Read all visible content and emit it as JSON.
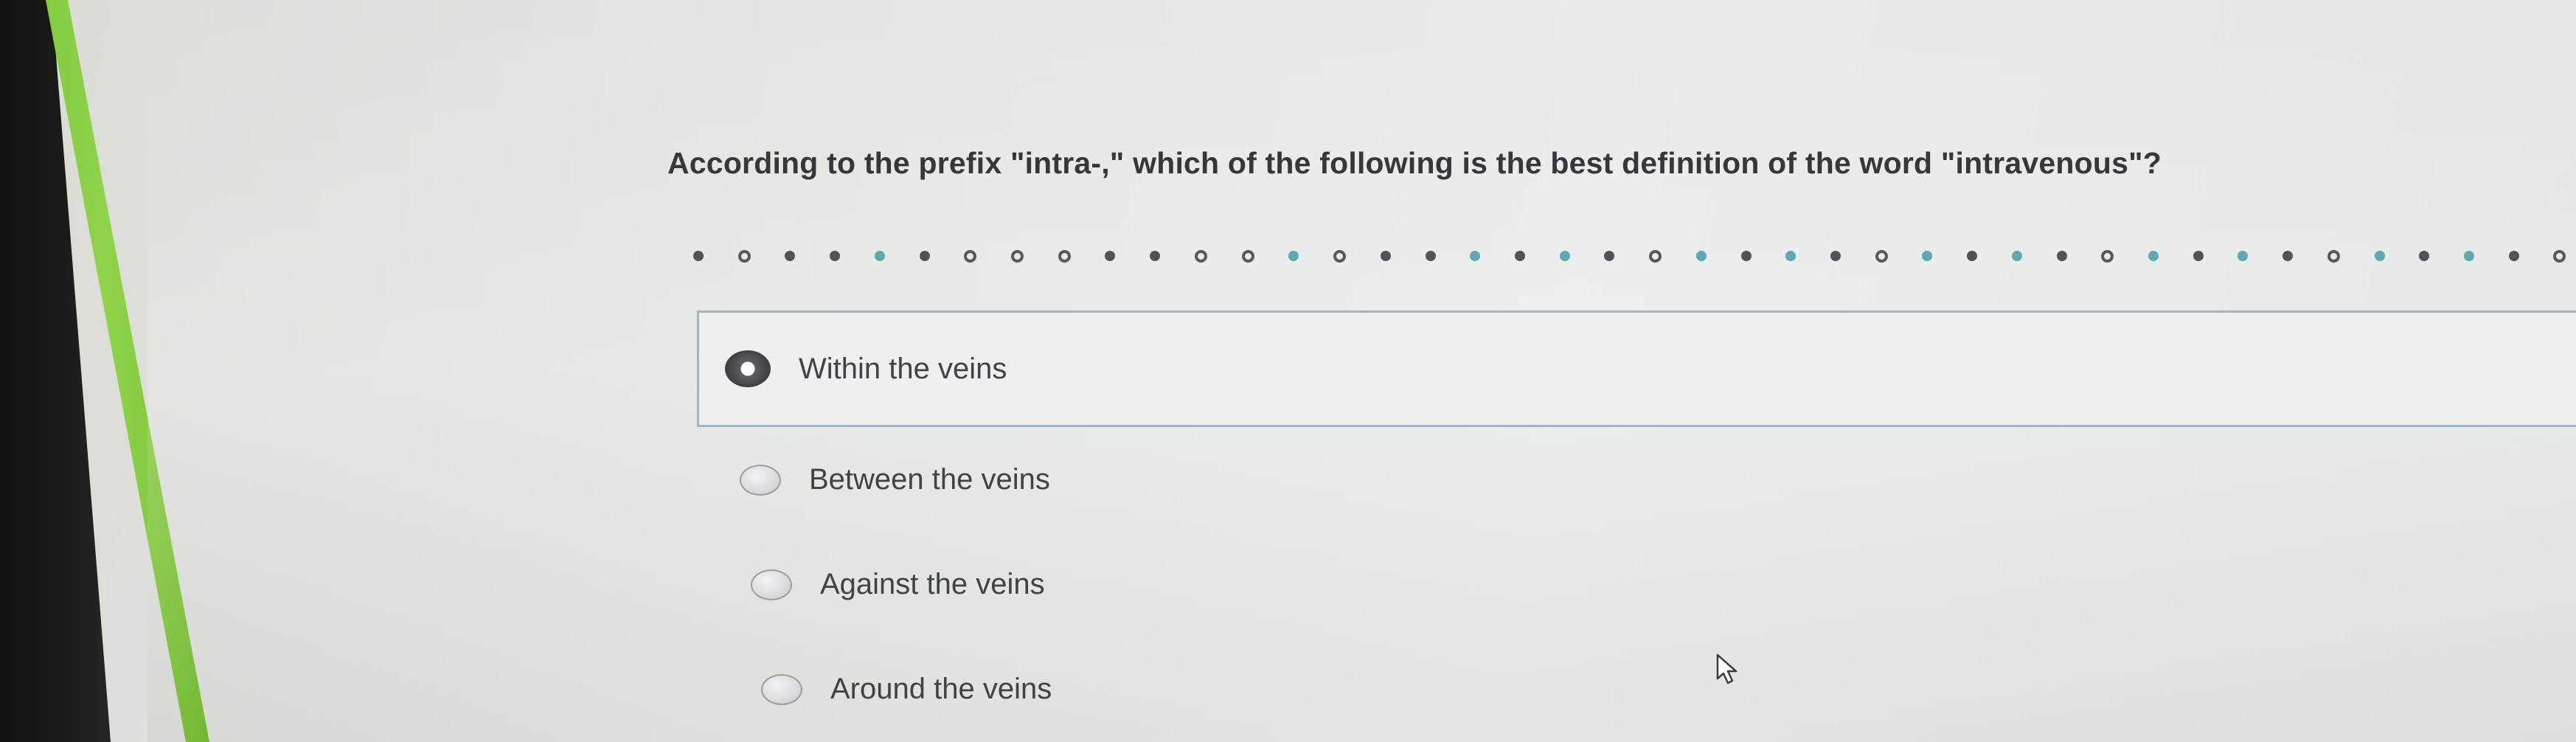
{
  "question": {
    "text": "According to the prefix \"intra-,\" which of the following is the best definition of the word \"intravenous\"?"
  },
  "options": [
    {
      "label": "Within the veins",
      "selected": true
    },
    {
      "label": "Between the veins",
      "selected": false
    },
    {
      "label": "Against the veins",
      "selected": false
    },
    {
      "label": "Around the veins",
      "selected": false
    }
  ],
  "colors": {
    "accent_green": "#7cc63a",
    "selected_border": "#9fb4c4",
    "text": "#34383a"
  },
  "icons": {
    "cursor": "mouse-pointer-icon",
    "divider": "dotted-divider"
  }
}
